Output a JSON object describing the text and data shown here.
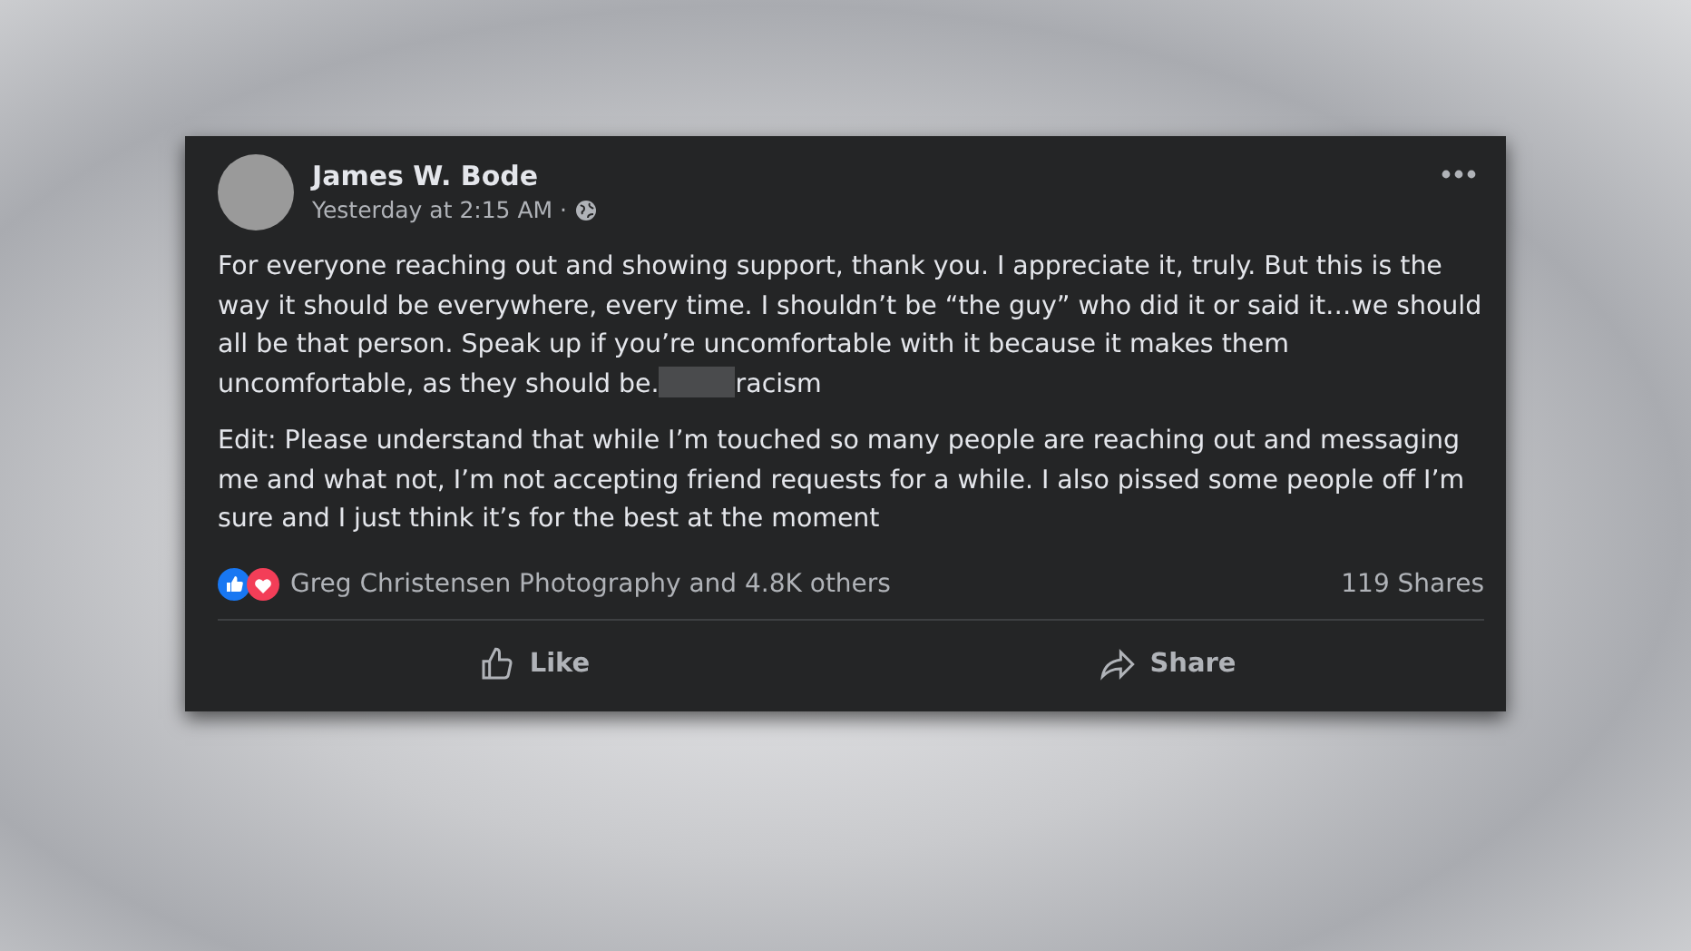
{
  "post": {
    "author": "James W. Bode",
    "timestamp": "Yesterday at 2:15 AM ·",
    "paragraphs": [
      {
        "before": "For everyone reaching out and showing support, thank you. I appreciate it, truly. But this is the way it should be everywhere, every time. I shouldn’t be “the guy” who did it or said it…we should all be that person. Speak up if you’re uncomfortable with it because it makes them uncomfortable, as they should be.",
        "redacted": true,
        "after": "racism"
      },
      {
        "before": "Edit: Please understand that while I’m touched so many people are reaching out and messaging me and what not, I’m not accepting friend requests for a while. I also pissed some people off I’m sure and I just think it’s for the best at the moment",
        "redacted": false
      }
    ],
    "reactions": "Greg Christensen Photography and 4.8K others",
    "shares": "119 Shares",
    "actions": [
      {
        "kind": "like",
        "label": "Like"
      },
      {
        "kind": "share",
        "label": "Share"
      }
    ]
  }
}
